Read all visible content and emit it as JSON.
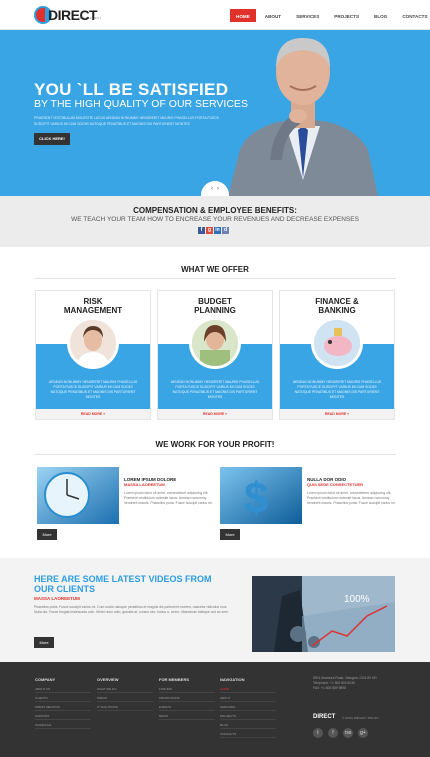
{
  "header": {
    "logo": "DIRECT",
    "logo_sub": "MANAGEMENT",
    "nav": [
      {
        "label": "HOME",
        "active": true
      },
      {
        "label": "ABOUT",
        "active": false
      },
      {
        "label": "SERVICES",
        "active": false
      },
      {
        "label": "PROJECTS",
        "active": false
      },
      {
        "label": "BLOG",
        "active": false
      },
      {
        "label": "CONTACTS",
        "active": false
      }
    ]
  },
  "hero": {
    "title": "YOU `LL BE SATISFIED",
    "subtitle": "BY THE HIGH QUALITY OF OUR SERVICES",
    "text": "PRAESENT VESTIBULUM MOLESTIE LACUS AENEAN NONUMMY HENDRERIT MAURIS PHASELLUS PORTA FUSCE SUSCIPIT VARIUS MI CUM SOCIIS NATOQUE PENATIBUS ET MAGNIS DIS PARTURIENT MONTES",
    "button": "CLICK HERE!"
  },
  "benefits": {
    "title": "COMPENSATION & EMPLOYEE BENEFITS:",
    "subtitle": "WE TEACH YOUR TEAM HOW TO ENCREASE YOUR REVENUES AND DECREASE EXPENSES"
  },
  "offer": {
    "title": "WHAT WE OFFER",
    "cards": [
      {
        "title1": "RISK",
        "title2": "MANAGEMENT",
        "text": "AENEAN NONUMMY HENDRERIT MAURIS PHASELLUS PORTA FUSCE SUSCIPIT VARIUS MI CUM SOCIIS NATOQUE PENATIBUS ET MAGNIS DIS PARTURIENT MONTES",
        "more": "READ MORE »"
      },
      {
        "title1": "BUDGET",
        "title2": "PLANNING",
        "text": "AENEAN NONUMMY HENDRERIT MAURIS PHASELLUS PORTA FUSCE SUSCIPIT VARIUS MI CUM SOCIIS NATOQUE PENATIBUS ET MAGNIS DIS PARTURIENT MONTES",
        "more": "READ MORE »"
      },
      {
        "title1": "FINANCE &",
        "title2": "BANKING",
        "text": "AENEAN NONUMMY HENDRERIT MAURIS PHASELLUS PORTA FUSCE SUSCIPIT VARIUS MI CUM SOCIIS NATOQUE PENATIBUS ET MAGNIS DIS PARTURIENT MONTES",
        "more": "READ MORE »"
      }
    ]
  },
  "profit": {
    "title": "WE WORK FOR YOUR PROFIT!",
    "items": [
      {
        "heading": "LOREM IPSUM DOLORE",
        "red": "MASSA LAOREETUM",
        "text": "Lorem ipsum dolor sit amet, consectetuer adipiscing elit. Praesent vestibulum molestie lacus. Aenean nonummy hendrerit mauris. Phasellus porta. Fusce suscipit varius mi.",
        "button": "More"
      },
      {
        "heading": "NULLA DOR ODIO",
        "red": "QUIS SEDE CONSECTETUER",
        "text": "Lorem ipsum dolor sit amet, consectetuer adipiscing elit. Praesent vestibulum molestie lacus. Aenean nonummy hendrerit mauris. Phasellus porta. Fusce suscipit varius mi.",
        "button": "More"
      }
    ]
  },
  "videos": {
    "title": "HERE ARE SOME LATEST VIDEOS FROM OUR CLIENTS",
    "red": "MASSA LAOREETUM",
    "text": "Phasellus porta. Fusce suscipit varius mi. Cum sociis natoque penatibus et magnis dis parturient montes, nascetur ridiculus mus. Nulla dui. Fusce feugiat malesuada odio. Morbi nunc odio, gravida at, cursus nec, luctus a, lorem. Maecenas tristique orci ac sem.",
    "button": "More",
    "image_text": "100%"
  },
  "footer": {
    "columns": [
      {
        "title": "COMPANY",
        "items": [
          "ABOUT US",
          "CLIENTS",
          "PRESS MENTION",
          "SUPPORT",
          "SCHEDULE"
        ],
        "red_index": -1
      },
      {
        "title": "OVERVIEW",
        "items": [
          "WHAT WE DO",
          "PRESS",
          "IT SOLUTIONS"
        ],
        "red_index": -1
      },
      {
        "title": "FOR MEMBERS",
        "items": [
          "FORUMS",
          "PROMOTIONS",
          "EVENTS",
          "NEWS"
        ],
        "red_index": -1
      },
      {
        "title": "NAVIGATION",
        "items": [
          "HOME",
          "ABOUT",
          "SERVICES",
          "PROJECTS",
          "BLOG",
          "CONTACTS"
        ],
        "red_index": 0
      }
    ],
    "address": "8901 Marmora Road, Glasgow, DO4 89 GR",
    "phone": "Telephone: +1 800 603 6035",
    "fax": "FAX: +1 800 889 9898",
    "brand": "DIRECT",
    "copyright": "© 2013 | PRIVACY POLICY",
    "social": [
      "t",
      "f",
      "rss",
      "g+"
    ]
  },
  "colors": {
    "accent_blue": "#3aa5e4",
    "accent_red": "#e0322a",
    "footer_bg": "#333333"
  }
}
